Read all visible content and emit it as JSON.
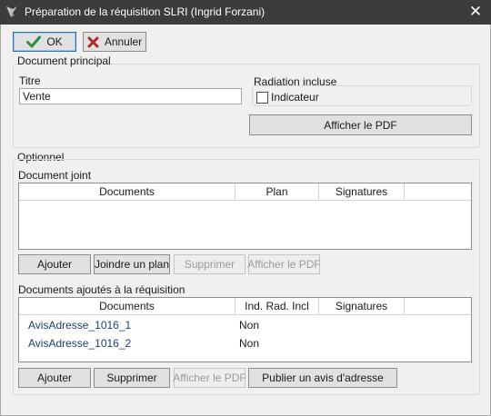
{
  "titlebar": {
    "title": "Préparation de la réquisition SLRI (Ingrid Forzani)",
    "close_glyph": "✕"
  },
  "toolbar": {
    "ok_label": "OK",
    "cancel_label": "Annuler"
  },
  "main_doc": {
    "group_label": "Document principal",
    "title_label": "Titre",
    "title_value": "Vente",
    "radiation_label": "Radiation incluse",
    "indicator_label": "Indicateur",
    "indicator_checked": false,
    "show_pdf_label": "Afficher le PDF"
  },
  "optional": {
    "group_label": "Optionnel",
    "attached": {
      "label": "Document joint",
      "columns": [
        "Documents",
        "Plan",
        "Signatures",
        ""
      ],
      "rows": [],
      "buttons": {
        "add": "Ajouter",
        "join_plan": "Joindre un plan",
        "delete": "Supprimer",
        "show_pdf": "Afficher le PDF"
      }
    },
    "added": {
      "label": "Documents ajoutés à la réquisition",
      "columns": [
        "Documents",
        "Ind. Rad. Incl",
        "Signatures",
        ""
      ],
      "rows": [
        {
          "document": "AvisAdresse_1016_1",
          "ind_rad": "Non",
          "signatures": ""
        },
        {
          "document": "AvisAdresse_1016_2",
          "ind_rad": "Non",
          "signatures": ""
        }
      ],
      "buttons": {
        "add": "Ajouter",
        "delete": "Supprimer",
        "show_pdf": "Afficher le PDF",
        "publish": "Publier un avis d'adresse"
      }
    }
  },
  "colors": {
    "titlebar_bg": "#3c3c3c",
    "ok_check": "#2e8b3c",
    "cancel_x": "#b02a2a",
    "link_text": "#1b3f73"
  },
  "icons": {
    "app": "app-logo-icon",
    "close": "close-icon",
    "ok": "checkmark-icon",
    "cancel": "x-mark-icon"
  }
}
